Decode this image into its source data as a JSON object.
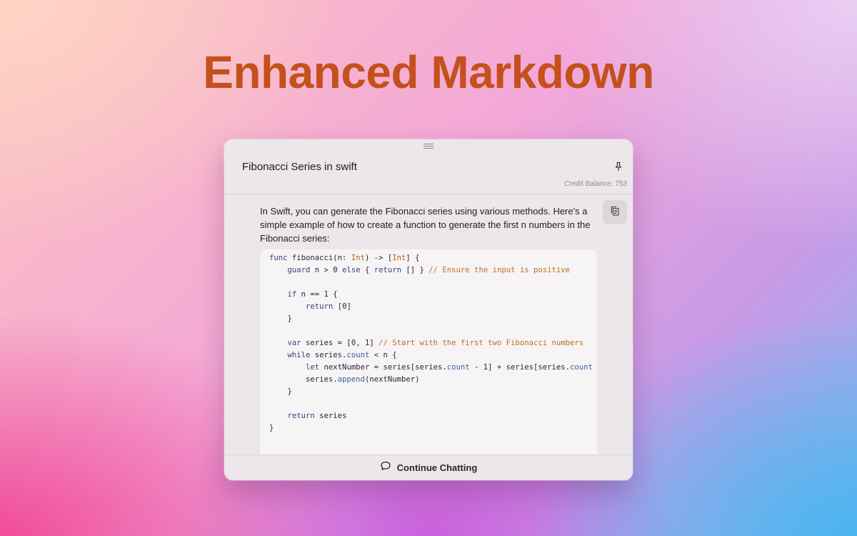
{
  "hero": {
    "title": "Enhanced Markdown"
  },
  "panel": {
    "title": "Fibonacci Series in swift",
    "credit_label": "Credit Balance:",
    "credit_value": "753",
    "intro_text": "In Swift, you can generate the Fibonacci series using various methods. Here's a simple example of how to create a function to generate the first n numbers in the Fibonacci series:",
    "code_language": "swift",
    "code_lines": [
      "func fibonacci(n: Int) -> [Int] {",
      "    guard n > 0 else { return [] } // Ensure the input is positive",
      "",
      "    if n == 1 {",
      "        return [0]",
      "    }",
      "",
      "    var series = [0, 1] // Start with the first two Fibonacci numbers",
      "    while series.count < n {",
      "        let nextNumber = series[series.count - 1] + series[series.count",
      "        series.append(nextNumber)",
      "    }",
      "",
      "    return series",
      "}"
    ],
    "continue_label": "Continue Chatting"
  },
  "icons": {
    "drag": "drag-handle-icon",
    "pin": "pin-icon",
    "copy": "copy-icon",
    "chat": "chat-bubble-icon"
  },
  "colors": {
    "hero_title": "#c4501c",
    "panel_bg": "#ece7ea",
    "code_bg": "#f6f4f5",
    "keyword": "#3a3f7d",
    "type": "#b5601a",
    "comment": "#c07021"
  }
}
